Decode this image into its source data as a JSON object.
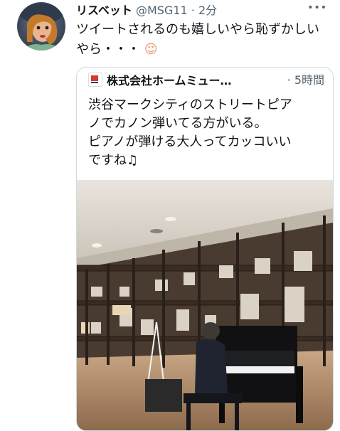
{
  "tweet": {
    "display_name": "リスベット",
    "handle": "@MSG11",
    "separator": " · ",
    "time": "2分",
    "text": "ツイートされるのも嬉しいやら恥ずかしいやら・・・",
    "emoji": "☺",
    "more_icon": "more-icon"
  },
  "quote": {
    "display_name": "株式会社ホームミュー…",
    "separator": " · ",
    "time": "5時間",
    "lines": [
      "渋谷マークシティのストリートピア",
      "ノでカノン弾いてる方がいる。",
      "ピアノが弾ける大人ってカッコいい",
      "ですね♫"
    ]
  },
  "colors": {
    "text": "#0f1419",
    "secondary": "#536471",
    "border": "#cfd9de"
  }
}
